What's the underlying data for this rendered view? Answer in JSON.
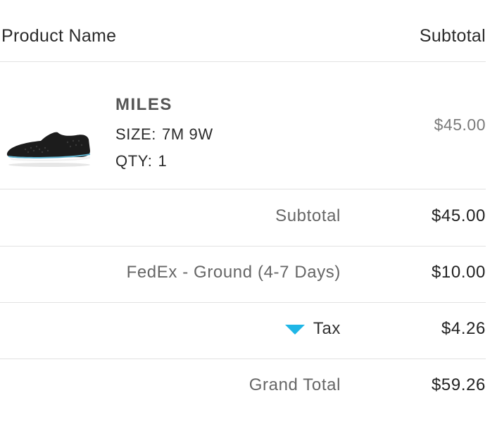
{
  "header": {
    "product_name_label": "Product Name",
    "subtotal_label": "Subtotal"
  },
  "product": {
    "name": "MILES",
    "size_label": "SIZE:",
    "size_value": "7M 9W",
    "qty_label": "QTY:",
    "qty_value": "1",
    "price": "$45.00",
    "image_icon": "shoe-image"
  },
  "summary": {
    "subtotal_label": "Subtotal",
    "subtotal_value": "$45.00",
    "shipping_label": "FedEx - Ground (4-7 Days)",
    "shipping_value": "$10.00",
    "tax_label": "Tax",
    "tax_value": "$4.26",
    "tax_toggle_icon": "triangle-down-icon",
    "grand_total_label": "Grand Total",
    "grand_total_value": "$59.26"
  },
  "colors": {
    "accent": "#1fb6e6",
    "divider": "#e2e2e2"
  }
}
